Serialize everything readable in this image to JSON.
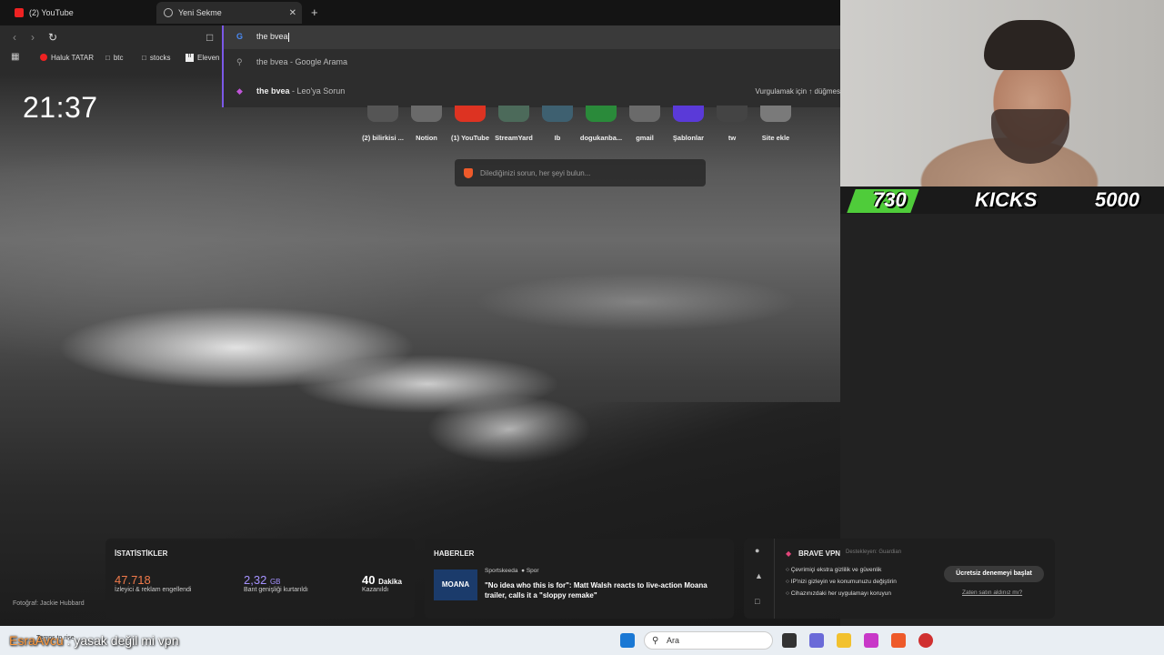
{
  "tabs": [
    {
      "label": "(2) YouTube",
      "active": false
    },
    {
      "label": "Yeni Sekme",
      "active": true
    }
  ],
  "toolbar": {
    "omnibox_value": "the bvea"
  },
  "bookmarks": [
    {
      "label": "Haluk TATAR",
      "icon": "youtube-icon"
    },
    {
      "label": "btc",
      "icon": "folder-icon"
    },
    {
      "label": "stocks",
      "icon": "folder-icon"
    },
    {
      "label": "Eleven",
      "icon": "elevenlabs-icon"
    }
  ],
  "suggestions": [
    {
      "query": "the bvea",
      "suffix": " - Google Arama",
      "icon": "search-icon"
    },
    {
      "query": "the bvea",
      "suffix": " - Leo'ya Sorun",
      "icon": "leo-icon"
    }
  ],
  "suggestion_hint": "Vurgulamak için ↑ düğmes",
  "clock": "21:37",
  "top_sites": [
    {
      "label": "(2) bilirkisi ..."
    },
    {
      "label": "Notion"
    },
    {
      "label": "(1) YouTube"
    },
    {
      "label": "StreamYard"
    },
    {
      "label": "Ib"
    },
    {
      "label": "dogukanba..."
    },
    {
      "label": "gmail"
    },
    {
      "label": "Şablonlar"
    },
    {
      "label": "tw"
    },
    {
      "label": "Site ekle"
    }
  ],
  "search_placeholder": "Dilediğinizi sorun, her şeyi bulun...",
  "stream_stats": {
    "kills": "730",
    "label": "KICKS",
    "goal": "5000"
  },
  "stats_widget": {
    "title": "İSTATİSTİKLER",
    "trackers_value": "47.718",
    "trackers_label": "İzleyici & reklam engellendi",
    "bandwidth_value": "2,32",
    "bandwidth_unit": "GB",
    "bandwidth_label": "Bant genişliği kurtarıldı",
    "time_value": "40",
    "time_unit": "Dakika",
    "time_label": "Kazanıldı"
  },
  "news_widget": {
    "title": "HABERLER",
    "source": "Sportskeeda",
    "category": "Spor",
    "headline": "\"No idea who this is for\": Matt Walsh reacts to live-action Moana trailer, calls it a \"sloppy remake\"",
    "thumb_text": "MOANA"
  },
  "vpn_widget": {
    "title": "BRAVE VPN",
    "supported_by": "Destekleyen:",
    "partner": "Guardian",
    "features": [
      "Çevrimiçi ekstra gizlilik ve güvenlik",
      "IP'nizi gizleyin ve konumunuzu değiştirin",
      "Cihazınızdaki her uygulamayı koruyun"
    ],
    "cta": "Ücretsiz denemeyi başlat",
    "link": "Zaten satın aldınız mı?"
  },
  "photo_credit": "Fotoğraf: Jackie Hubbard",
  "chat_overlay": {
    "user": "EsraAvcu",
    "message": " : yasak değil mi vpn"
  },
  "taskbar": {
    "search_label": "Ara",
    "tray_text": "Temps to rise"
  },
  "colors": {
    "accent": "#7b58e8",
    "brave_orange": "#ee5a2a",
    "stats_orange": "#f07a4a",
    "stats_purple": "#a592ff",
    "kills_green": "#4fcc3a"
  }
}
